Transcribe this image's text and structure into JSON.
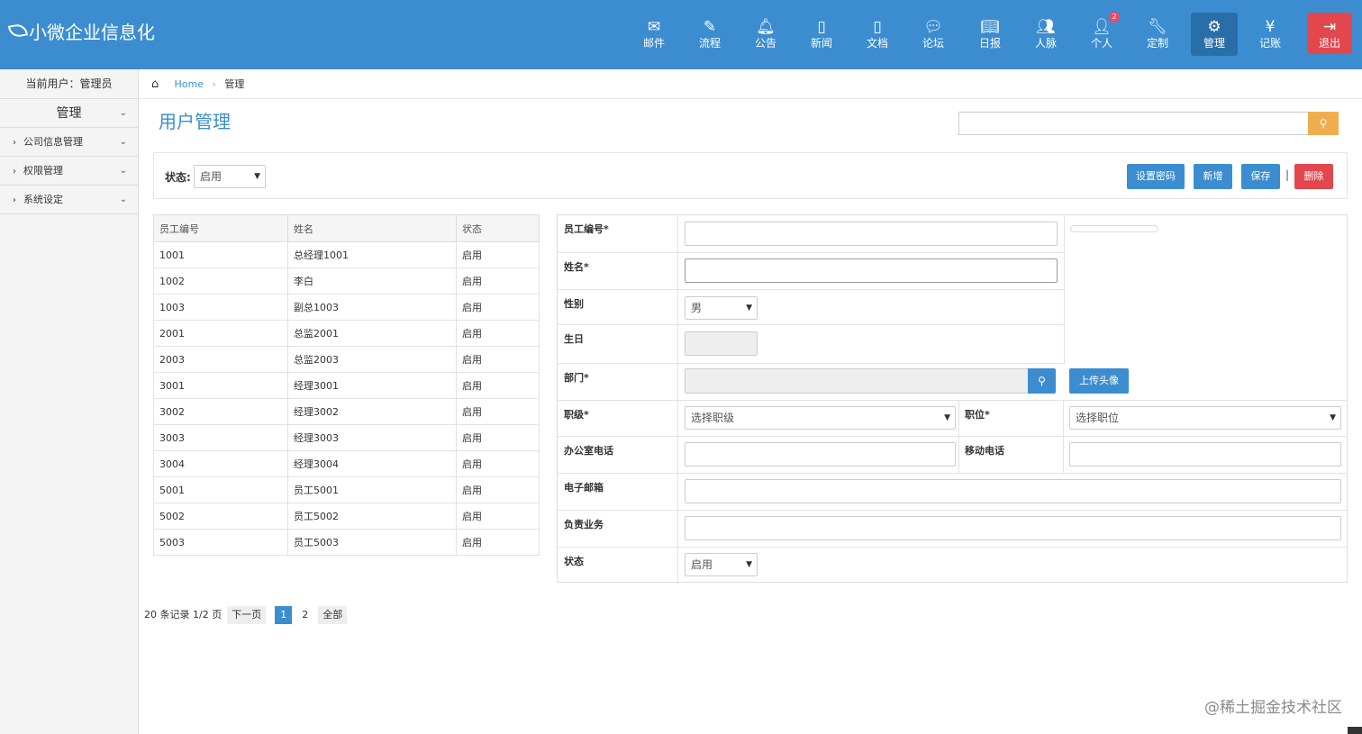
{
  "app": {
    "title": "小微企业信息化"
  },
  "nav": [
    {
      "label": "邮件",
      "icon": "mail-icon",
      "glyph": "✉"
    },
    {
      "label": "流程",
      "icon": "pencil-icon",
      "glyph": "✎"
    },
    {
      "label": "公告",
      "icon": "bell-icon",
      "glyph": "🔔︎"
    },
    {
      "label": "新闻",
      "icon": "file-icon",
      "glyph": "▯"
    },
    {
      "label": "文档",
      "icon": "document-icon",
      "glyph": "▯"
    },
    {
      "label": "论坛",
      "icon": "comments-icon",
      "glyph": "💬︎"
    },
    {
      "label": "日报",
      "icon": "book-icon",
      "glyph": "📖︎"
    },
    {
      "label": "人脉",
      "icon": "users-icon",
      "glyph": "👥︎"
    },
    {
      "label": "个人",
      "icon": "user-icon",
      "glyph": "👤︎",
      "badge": "2"
    },
    {
      "label": "定制",
      "icon": "wrench-icon",
      "glyph": "🔧︎"
    },
    {
      "label": "管理",
      "icon": "cogs-icon",
      "glyph": "⚙"
    },
    {
      "label": "记账",
      "icon": "yen-icon",
      "glyph": "¥"
    },
    {
      "label": "退出",
      "icon": "sign-out-icon",
      "glyph": "⇥"
    }
  ],
  "sidebar": {
    "current_user": "当前用户：管理员",
    "menu_title": "管理",
    "items": [
      "公司信息管理",
      "权限管理",
      "系统设定"
    ]
  },
  "breadcrumb": {
    "home": "Home",
    "current": "管理"
  },
  "page_title": "用户管理",
  "toolbar": {
    "status_label": "状态:",
    "status_value": "启用",
    "buttons": {
      "set_password": "设置密码",
      "add": "新增",
      "save": "保存",
      "delete": "删除"
    },
    "separator": "|"
  },
  "table": {
    "headers": [
      "员工编号",
      "姓名",
      "状态"
    ],
    "rows": [
      [
        "1001",
        "总经理1001",
        "启用"
      ],
      [
        "1002",
        "李白",
        "启用"
      ],
      [
        "1003",
        "副总1003",
        "启用"
      ],
      [
        "2001",
        "总监2001",
        "启用"
      ],
      [
        "2003",
        "总监2003",
        "启用"
      ],
      [
        "3001",
        "经理3001",
        "启用"
      ],
      [
        "3002",
        "经理3002",
        "启用"
      ],
      [
        "3003",
        "经理3003",
        "启用"
      ],
      [
        "3004",
        "经理3004",
        "启用"
      ],
      [
        "5001",
        "员工5001",
        "启用"
      ],
      [
        "5002",
        "员工5002",
        "启用"
      ],
      [
        "5003",
        "员工5003",
        "启用"
      ]
    ]
  },
  "pager": {
    "summary": "20 条记录 1/2 页",
    "next": "下一页",
    "page1": "1",
    "page2": "2",
    "all": "全部"
  },
  "form": {
    "emp_no": "员工编号*",
    "name": "姓名*",
    "gender": "性别",
    "gender_value": "男",
    "birthday": "生日",
    "dept": "部门*",
    "upload_avatar": "上传头像",
    "rank": "职级*",
    "rank_placeholder": "选择职级",
    "position": "职位*",
    "position_placeholder": "选择职位",
    "office_phone": "办公室电话",
    "mobile": "移动电话",
    "email": "电子邮箱",
    "business": "负责业务",
    "status": "状态",
    "status_value": "启用"
  },
  "watermark": "@稀土掘金技术社区",
  "colors": {
    "header": "#3c8dd0",
    "warning": "#f0ad4e",
    "danger": "#e1474c"
  }
}
